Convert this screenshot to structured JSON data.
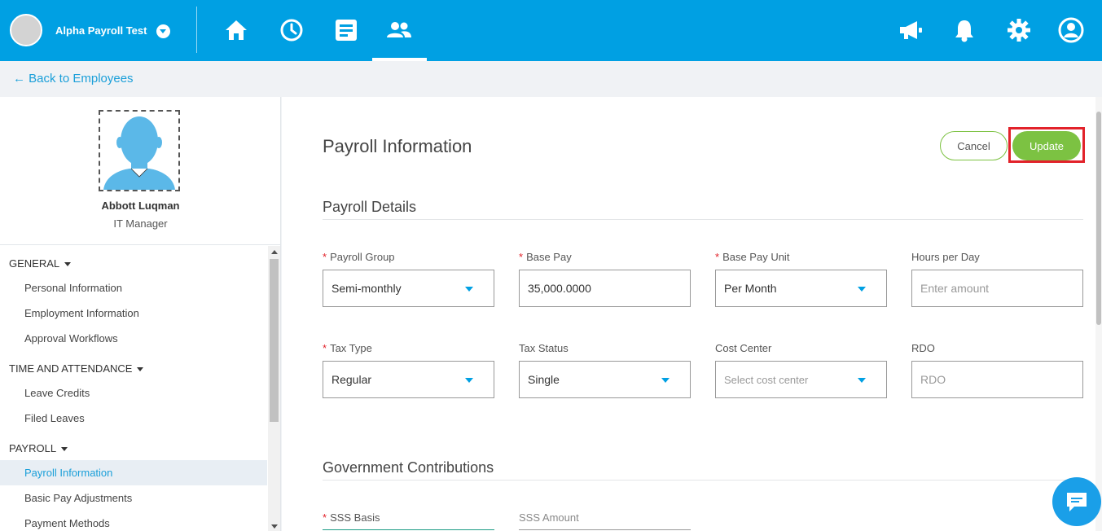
{
  "header": {
    "company_name": "Alpha Payroll Test",
    "nav_icons": [
      "home-icon",
      "clock-icon",
      "document-icon",
      "people-icon"
    ],
    "right_icons": [
      "megaphone-icon",
      "bell-icon",
      "gear-icon",
      "user-icon"
    ],
    "brand_color": "#00a0e3"
  },
  "breadcrumb": {
    "back_label": "← Back to Employees"
  },
  "employee": {
    "name": "Abbott Luqman",
    "title": "IT Manager"
  },
  "sidebar": {
    "sections": [
      {
        "heading": "GENERAL",
        "items": [
          "Personal Information",
          "Employment Information",
          "Approval Workflows"
        ]
      },
      {
        "heading": "TIME AND ATTENDANCE",
        "items": [
          "Leave Credits",
          "Filed Leaves"
        ]
      },
      {
        "heading": "PAYROLL",
        "items": [
          "Payroll Information",
          "Basic Pay Adjustments",
          "Payment Methods"
        ]
      }
    ],
    "active_item": "Payroll Information"
  },
  "page": {
    "title": "Payroll Information",
    "cancel_label": "Cancel",
    "update_label": "Update",
    "accent_color": "#7cc242"
  },
  "payroll_details": {
    "title": "Payroll Details",
    "fields": [
      {
        "label": "Payroll Group",
        "required": "*",
        "value": "Semi-monthly",
        "type": "select"
      },
      {
        "label": "Base Pay",
        "required": "*",
        "value": "35,000.0000",
        "type": "input"
      },
      {
        "label": "Base Pay Unit",
        "required": "*",
        "value": "Per Month",
        "type": "select"
      },
      {
        "label": "Hours per Day",
        "required": "",
        "placeholder": "Enter amount",
        "type": "input"
      },
      {
        "label": "Tax Type",
        "required": "*",
        "value": "Regular",
        "type": "select"
      },
      {
        "label": "Tax Status",
        "required": "",
        "value": "Single",
        "type": "select"
      },
      {
        "label": "Cost Center",
        "required": "",
        "placeholder": "Select cost center",
        "type": "select"
      },
      {
        "label": "RDO",
        "required": "",
        "placeholder": "RDO",
        "type": "input"
      }
    ]
  },
  "government_contributions": {
    "title": "Government Contributions",
    "fields": [
      {
        "label": "SSS Basis",
        "required": "*"
      },
      {
        "label": "SSS Amount",
        "required": ""
      }
    ]
  }
}
